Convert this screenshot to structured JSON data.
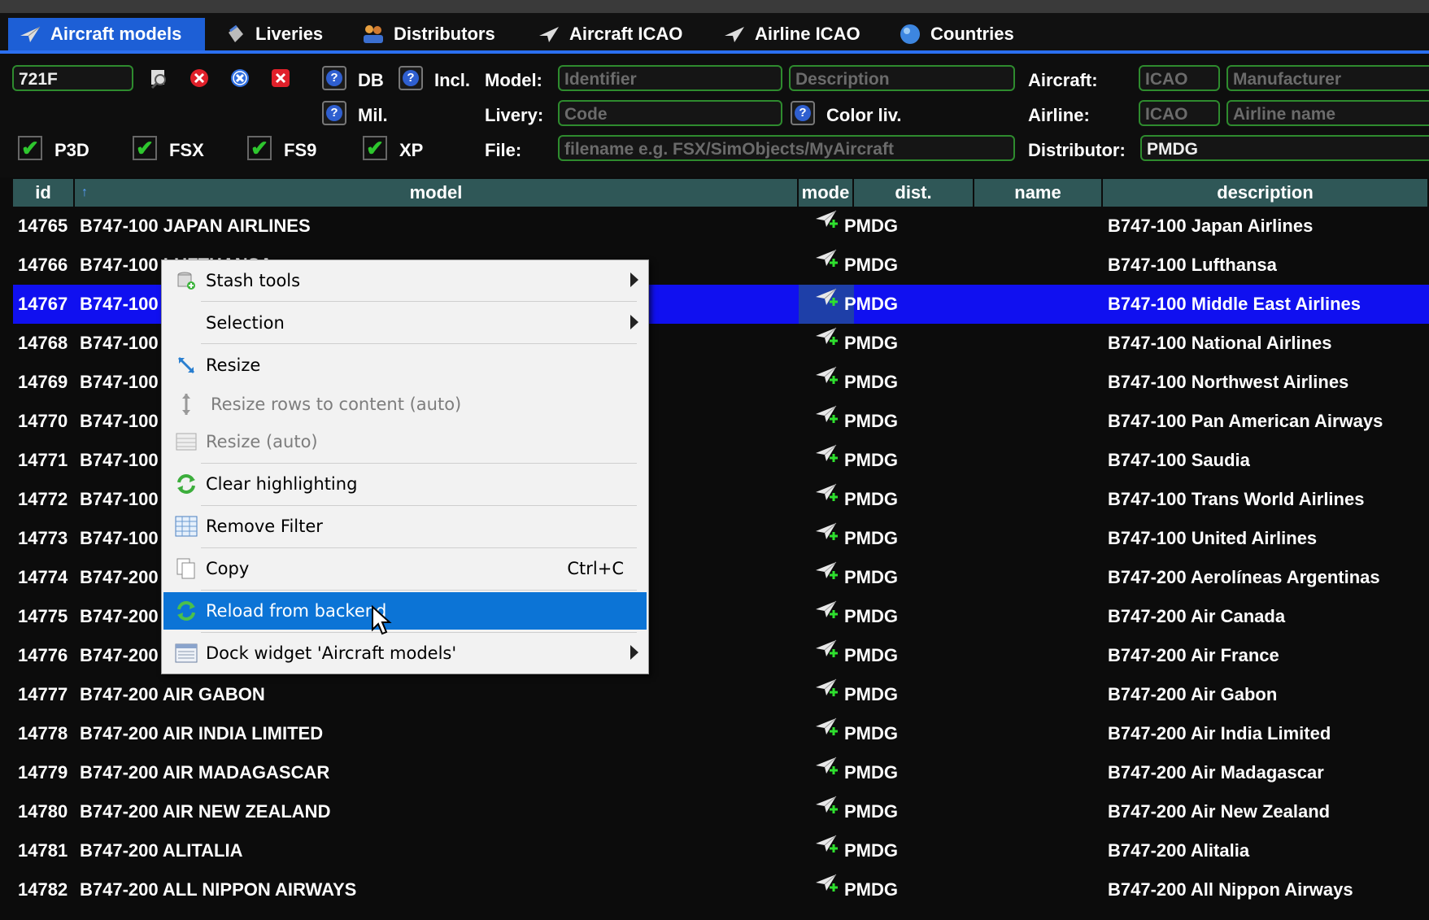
{
  "tabs": [
    {
      "label": "Aircraft models",
      "icon": "airplane-icon",
      "active": true
    },
    {
      "label": "Liveries",
      "icon": "paint-bucket-icon"
    },
    {
      "label": "Distributors",
      "icon": "people-icon"
    },
    {
      "label": "Aircraft ICAO",
      "icon": "airplane-icon"
    },
    {
      "label": "Airline ICAO",
      "icon": "airplane-icon"
    },
    {
      "label": "Countries",
      "icon": "globe-icon"
    }
  ],
  "filter": {
    "search_value": "721F",
    "db_label": "DB",
    "incl_label": "Incl.",
    "mil_label": "Mil.",
    "model_label": "Model:",
    "model_identifier_ph": "Identifier",
    "model_description_ph": "Description",
    "livery_label": "Livery:",
    "livery_code_ph": "Code",
    "color_liv_label": "Color liv.",
    "file_label": "File:",
    "file_ph": "filename e.g. FSX/SimObjects/MyAircraft",
    "aircraft_label": "Aircraft:",
    "aircraft_icao_ph": "ICAO",
    "aircraft_manufacturer_ph": "Manufacturer",
    "airline_label": "Airline:",
    "airline_icao_ph": "ICAO",
    "airline_name_ph": "Airline name",
    "distributor_label": "Distributor:",
    "distributor_value": "PMDG",
    "simulators": [
      {
        "label": "P3D",
        "checked": true
      },
      {
        "label": "FSX",
        "checked": true
      },
      {
        "label": "FS9",
        "checked": true
      },
      {
        "label": "XP",
        "checked": true
      }
    ]
  },
  "table": {
    "columns": [
      "id",
      "model",
      "mode",
      "dist.",
      "name",
      "description"
    ],
    "sort_indicator": "↑",
    "rows": [
      {
        "id": "14765",
        "model": "B747-100 JAPAN AIRLINES",
        "dist": "PMDG",
        "name": "",
        "description": "B747-100 Japan Airlines"
      },
      {
        "id": "14766",
        "model": "B747-100 LUFTHANSA",
        "dist": "PMDG",
        "name": "",
        "description": "B747-100 Lufthansa"
      },
      {
        "id": "14767",
        "model": "B747-100",
        "dist": "PMDG",
        "name": "",
        "description": "B747-100 Middle East Airlines",
        "selected": true
      },
      {
        "id": "14768",
        "model": "B747-100",
        "dist": "PMDG",
        "name": "",
        "description": "B747-100 National Airlines"
      },
      {
        "id": "14769",
        "model": "B747-100",
        "dist": "PMDG",
        "name": "",
        "description": "B747-100 Northwest Airlines"
      },
      {
        "id": "14770",
        "model": "B747-100",
        "dist": "PMDG",
        "name": "",
        "description": "B747-100 Pan American Airways"
      },
      {
        "id": "14771",
        "model": "B747-100",
        "dist": "PMDG",
        "name": "",
        "description": "B747-100 Saudia"
      },
      {
        "id": "14772",
        "model": "B747-100",
        "dist": "PMDG",
        "name": "",
        "description": "B747-100 Trans World Airlines"
      },
      {
        "id": "14773",
        "model": "B747-100",
        "dist": "PMDG",
        "name": "",
        "description": "B747-100 United Airlines"
      },
      {
        "id": "14774",
        "model": "B747-200",
        "dist": "PMDG",
        "name": "",
        "description": "B747-200 Aerolíneas Argentinas"
      },
      {
        "id": "14775",
        "model": "B747-200",
        "dist": "PMDG",
        "name": "",
        "description": "B747-200 Air Canada"
      },
      {
        "id": "14776",
        "model": "B747-200",
        "dist": "PMDG",
        "name": "",
        "description": "B747-200 Air France"
      },
      {
        "id": "14777",
        "model": "B747-200 AIR GABON",
        "dist": "PMDG",
        "name": "",
        "description": "B747-200 Air Gabon"
      },
      {
        "id": "14778",
        "model": "B747-200 AIR INDIA LIMITED",
        "dist": "PMDG",
        "name": "",
        "description": "B747-200 Air India Limited"
      },
      {
        "id": "14779",
        "model": "B747-200 AIR MADAGASCAR",
        "dist": "PMDG",
        "name": "",
        "description": "B747-200 Air Madagascar"
      },
      {
        "id": "14780",
        "model": "B747-200 AIR NEW ZEALAND",
        "dist": "PMDG",
        "name": "",
        "description": "B747-200 Air New Zealand"
      },
      {
        "id": "14781",
        "model": "B747-200 ALITALIA",
        "dist": "PMDG",
        "name": "",
        "description": "B747-200 Alitalia"
      },
      {
        "id": "14782",
        "model": "B747-200 ALL NIPPON AIRWAYS",
        "dist": "PMDG",
        "name": "",
        "description": "B747-200 All Nippon Airways"
      }
    ]
  },
  "context_menu": {
    "items": [
      {
        "label": "Stash tools",
        "icon": "stash-icon",
        "submenu": true
      },
      {
        "label": "Selection",
        "icon": "",
        "submenu": true
      },
      {
        "label": "Resize",
        "icon": "resize-icon"
      },
      {
        "label": "Resize rows to content (auto)",
        "icon": "resize-rows-icon",
        "disabled": true
      },
      {
        "label": "Resize (auto)",
        "icon": "table-icon",
        "disabled": true
      },
      {
        "label": "Clear highlighting",
        "icon": "refresh-icon"
      },
      {
        "label": "Remove Filter",
        "icon": "filter-table-icon"
      },
      {
        "label": "Copy",
        "icon": "copy-icon",
        "shortcut": "Ctrl+C"
      },
      {
        "label": "Reload from backend",
        "icon": "reload-icon",
        "highlighted": true
      },
      {
        "label": "Dock widget 'Aircraft models'",
        "icon": "dock-icon",
        "submenu": true
      }
    ]
  },
  "colors": {
    "tab_active": "#1d5fd6",
    "header_bg": "#2f5757",
    "selected_row": "#1010f0",
    "field_border": "#2e8b2e",
    "menu_highlight": "#0c74d6"
  }
}
